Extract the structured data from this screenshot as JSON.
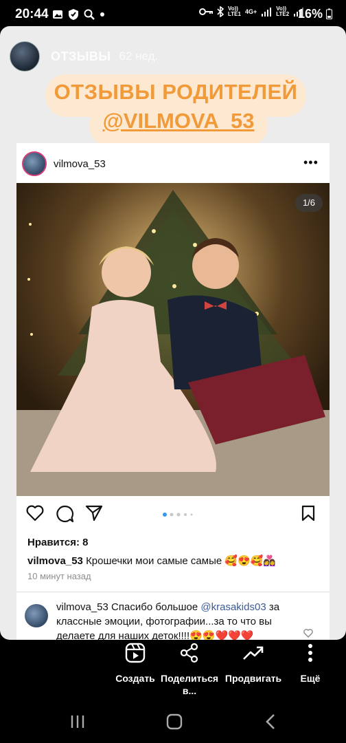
{
  "status_bar": {
    "time": "20:44",
    "battery": "16%",
    "net1": "Vo))\nLTE1",
    "net2": "4G+",
    "net3": "Vo))\nLTE2"
  },
  "story": {
    "account": "ОТЗЫВЫ",
    "age": "62 нед.",
    "headline_line1": "ОТЗЫВЫ РОДИТЕЛЕЙ",
    "headline_line2": "@VILMOVA_53"
  },
  "post": {
    "username": "vilmova_53",
    "more": "•••",
    "carousel_indicator": "1/6",
    "likes": "Нравится: 8",
    "caption_user": "vilmova_53",
    "caption_text": "Крошечки мои самые самые 🥰😍🥰👩‍❤️‍👩",
    "time_ago": "10 минут назад",
    "comment": {
      "user": "vilmova_53",
      "text_before": "Спасибо большое",
      "mention": "@krasakids03",
      "text_after": "за классные эмоции, фотографии...за то что вы делаете для наших деток!!!!😍😍❤️❤️❤️"
    }
  },
  "actions": {
    "create": "Создать",
    "share": "Поделиться в...",
    "promote": "Продвигать",
    "more": "Ещё"
  },
  "colors": {
    "accent_orange": "#f09a3a",
    "pill_bg": "#fde8d1",
    "link_blue": "#3b5998",
    "active_dot": "#3897f0"
  }
}
